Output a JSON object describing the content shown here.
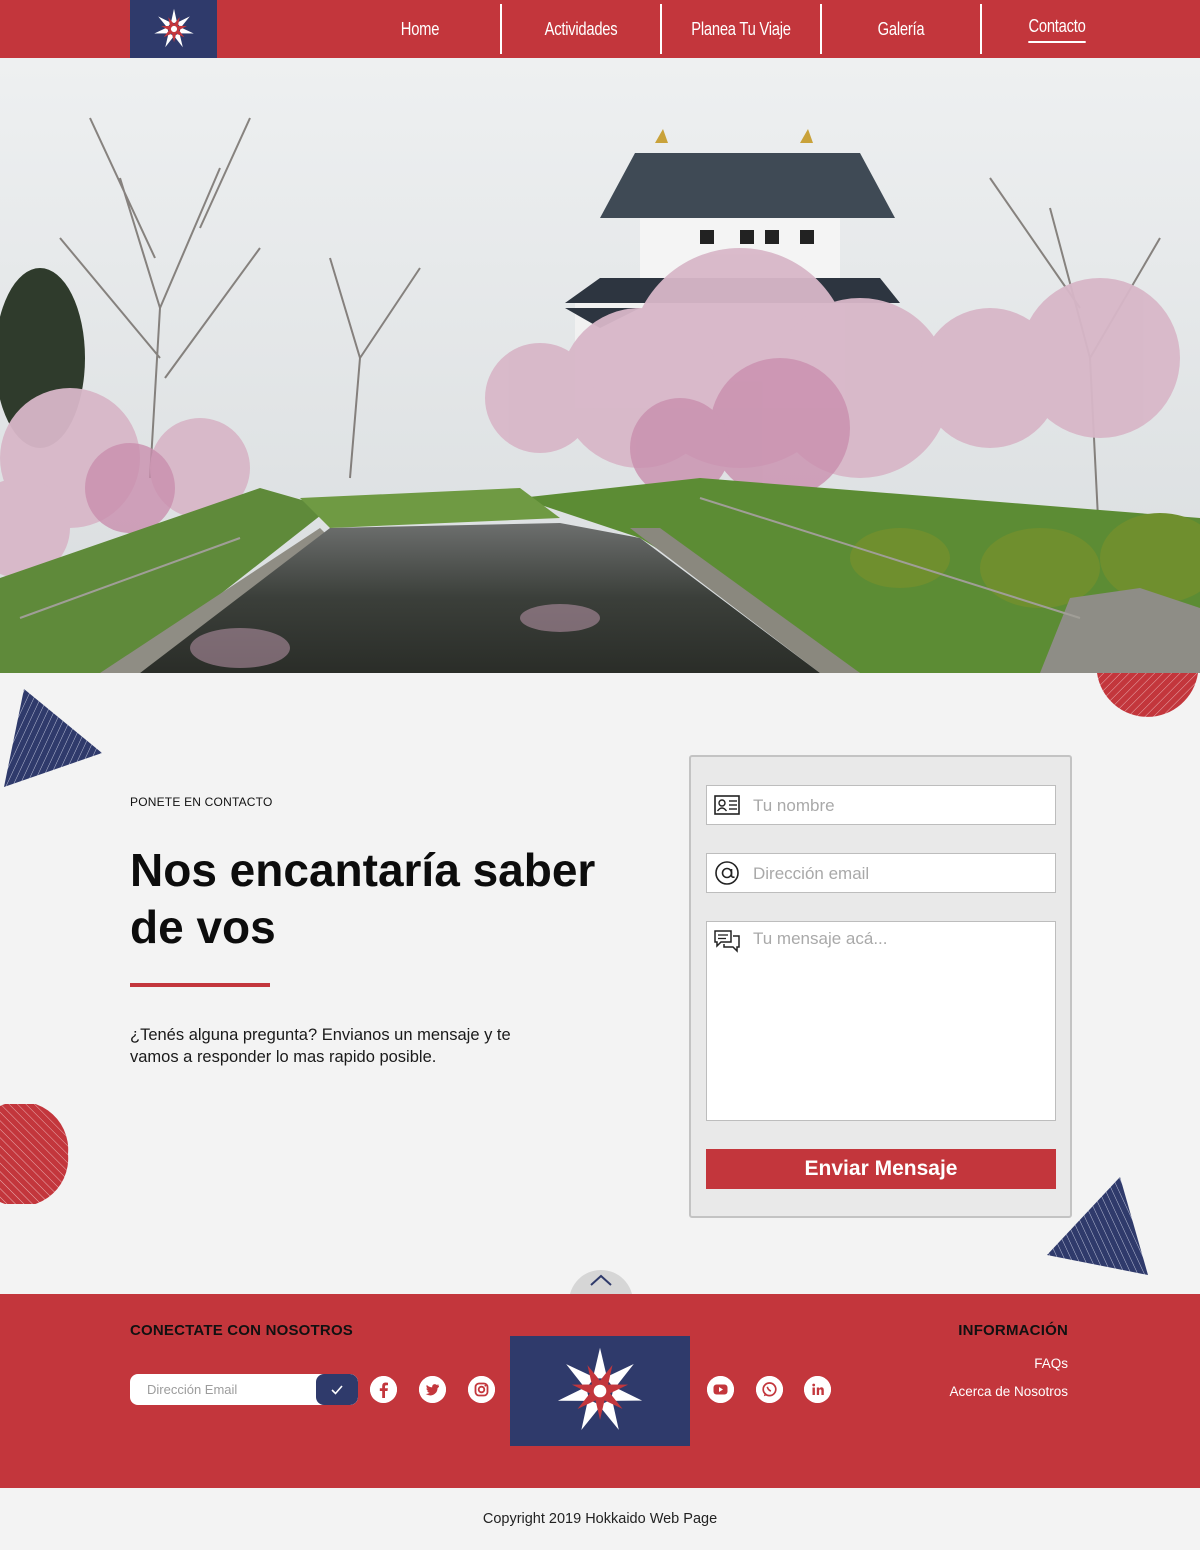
{
  "colors": {
    "red": "#c3363c",
    "navy": "#2f3a6b"
  },
  "nav": {
    "logo_icon": "hokkaido-star-icon",
    "items": [
      {
        "label": "Home"
      },
      {
        "label": "Actividades"
      },
      {
        "label": "Planea Tu Viaje"
      },
      {
        "label": "Galería"
      },
      {
        "label": "Contacto",
        "active": true
      }
    ]
  },
  "hero": {
    "image": "castle-cherry-blossoms-photo"
  },
  "contact": {
    "eyebrow": "PONETE EN CONTACTO",
    "headline": "Nos encantaría saber de vos",
    "intro": "¿Tenés alguna pregunta? Envianos un mensaje y te vamos a responder lo mas rapido posible.",
    "form": {
      "name_placeholder": "Tu nombre",
      "email_placeholder": "Dirección email",
      "message_placeholder": "Tu mensaje acá...",
      "submit_label": "Enviar Mensaje"
    }
  },
  "footer": {
    "connect_heading": "CONECTATE CON NOSOTROS",
    "email_placeholder": "Dirección Email",
    "social_left": [
      "facebook-icon",
      "twitter-icon",
      "instagram-icon"
    ],
    "social_right": [
      "youtube-icon",
      "whatsapp-icon",
      "linkedin-icon"
    ],
    "info_heading": "INFORMACIÓN",
    "info_links": [
      "FAQs",
      "Acerca de Nosotros"
    ]
  },
  "copyright": "Copyright 2019 Hokkaido Web Page"
}
